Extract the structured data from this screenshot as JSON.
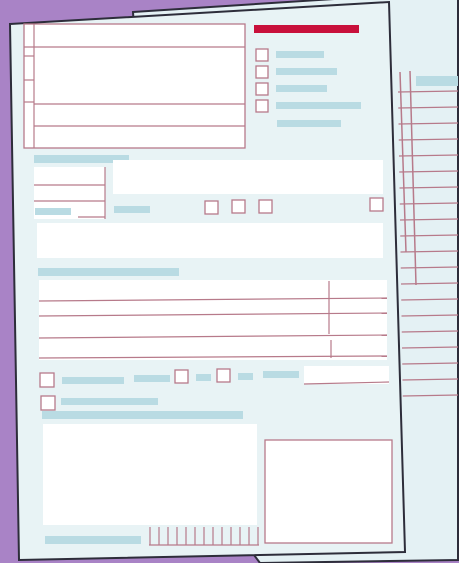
{
  "colors": {
    "background": "#a983c6",
    "paper": "#e8f3f5",
    "paper_back": "#e4f1f4",
    "outline": "#2d2d3a",
    "form_line": "#b77a8a",
    "accent_bar": "#c8103b",
    "placeholder": "#b9dbe3",
    "field_fill": "#ffffff"
  },
  "scene": {
    "description_icon_name": "document-form-illustration"
  },
  "front_form": {
    "checkbox_groups": [
      {
        "name": "top-right-checklist",
        "count": 4
      },
      {
        "name": "mid-row-checkboxes",
        "count": 3
      },
      {
        "name": "right-single-checkbox",
        "count": 1
      },
      {
        "name": "bottom-row-checkboxes",
        "count": 3
      },
      {
        "name": "bottom-left-checkbox",
        "count": 1
      }
    ]
  },
  "back_form": {
    "ruled_rows": 20
  }
}
